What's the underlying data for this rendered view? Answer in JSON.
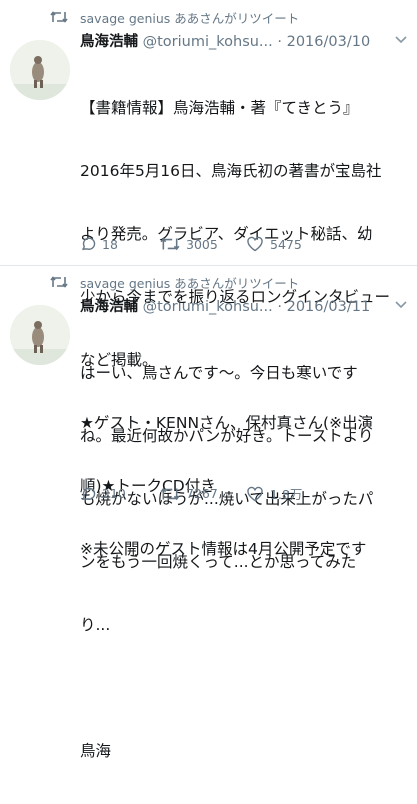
{
  "tweets": [
    {
      "retweet_by": "savage genius ああさんがリツイート",
      "name": "鳥海浩輔",
      "handle": "@toriumi_kohsu...",
      "dot": "·",
      "date": "2016/03/10",
      "lines": [
        "【書籍情報】鳥海浩輔・著『てきとう』",
        "2016年5月16日、鳥海氏初の著書が宝島社",
        "より発売。グラビア、ダイエット秘話、幼",
        "少から今までを振り返るロングインタビュー",
        "など掲載。",
        "★ゲスト・KENNさん、保村真さん(※出演",
        "順)★トークCD付き",
        "※未公開のゲスト情報は4月公開予定です"
      ],
      "replies": "18",
      "retweets": "3005",
      "likes": "5475"
    },
    {
      "retweet_by": "savage genius ああさんがリツイート",
      "name": "鳥海浩輔",
      "handle": "@toriumi_kohsu...",
      "dot": "·",
      "date": "2016/03/11",
      "lines": [
        "はーい、鳥さんです〜。今日も寒いです",
        "ね。最近何故かパンが好き。トーストより",
        "も焼かないほうが...焼いて出来上がったパ",
        "ンをもう一回焼くって...とか思ってみた",
        "り...",
        "",
        "鳥海"
      ],
      "replies": "210",
      "retweets": "7267",
      "likes": "1.8万"
    }
  ],
  "icons": [
    "retweet-icon",
    "chevron-down-icon",
    "reply-icon",
    "like-icon"
  ],
  "colors": {
    "text": "#14171a",
    "secondary": "#657786",
    "divider": "#e1e8ed"
  }
}
